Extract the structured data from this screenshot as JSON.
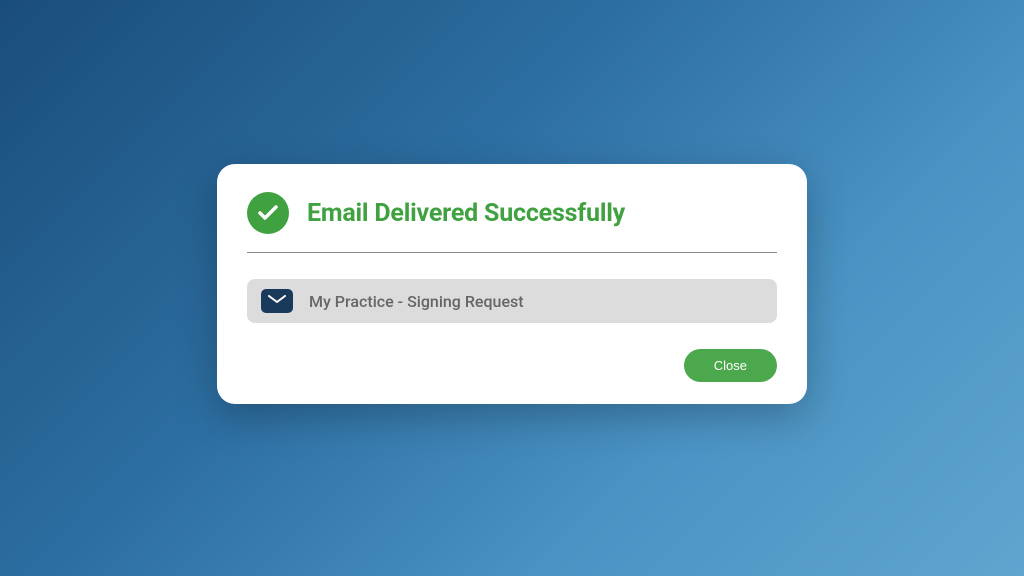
{
  "modal": {
    "title": "Email Delivered Successfully",
    "email": {
      "subject": "My Practice - Signing Request"
    },
    "close_label": "Close"
  },
  "colors": {
    "success": "#3fa13f",
    "button": "#4ca84c",
    "envelope": "#1a3a5c"
  }
}
